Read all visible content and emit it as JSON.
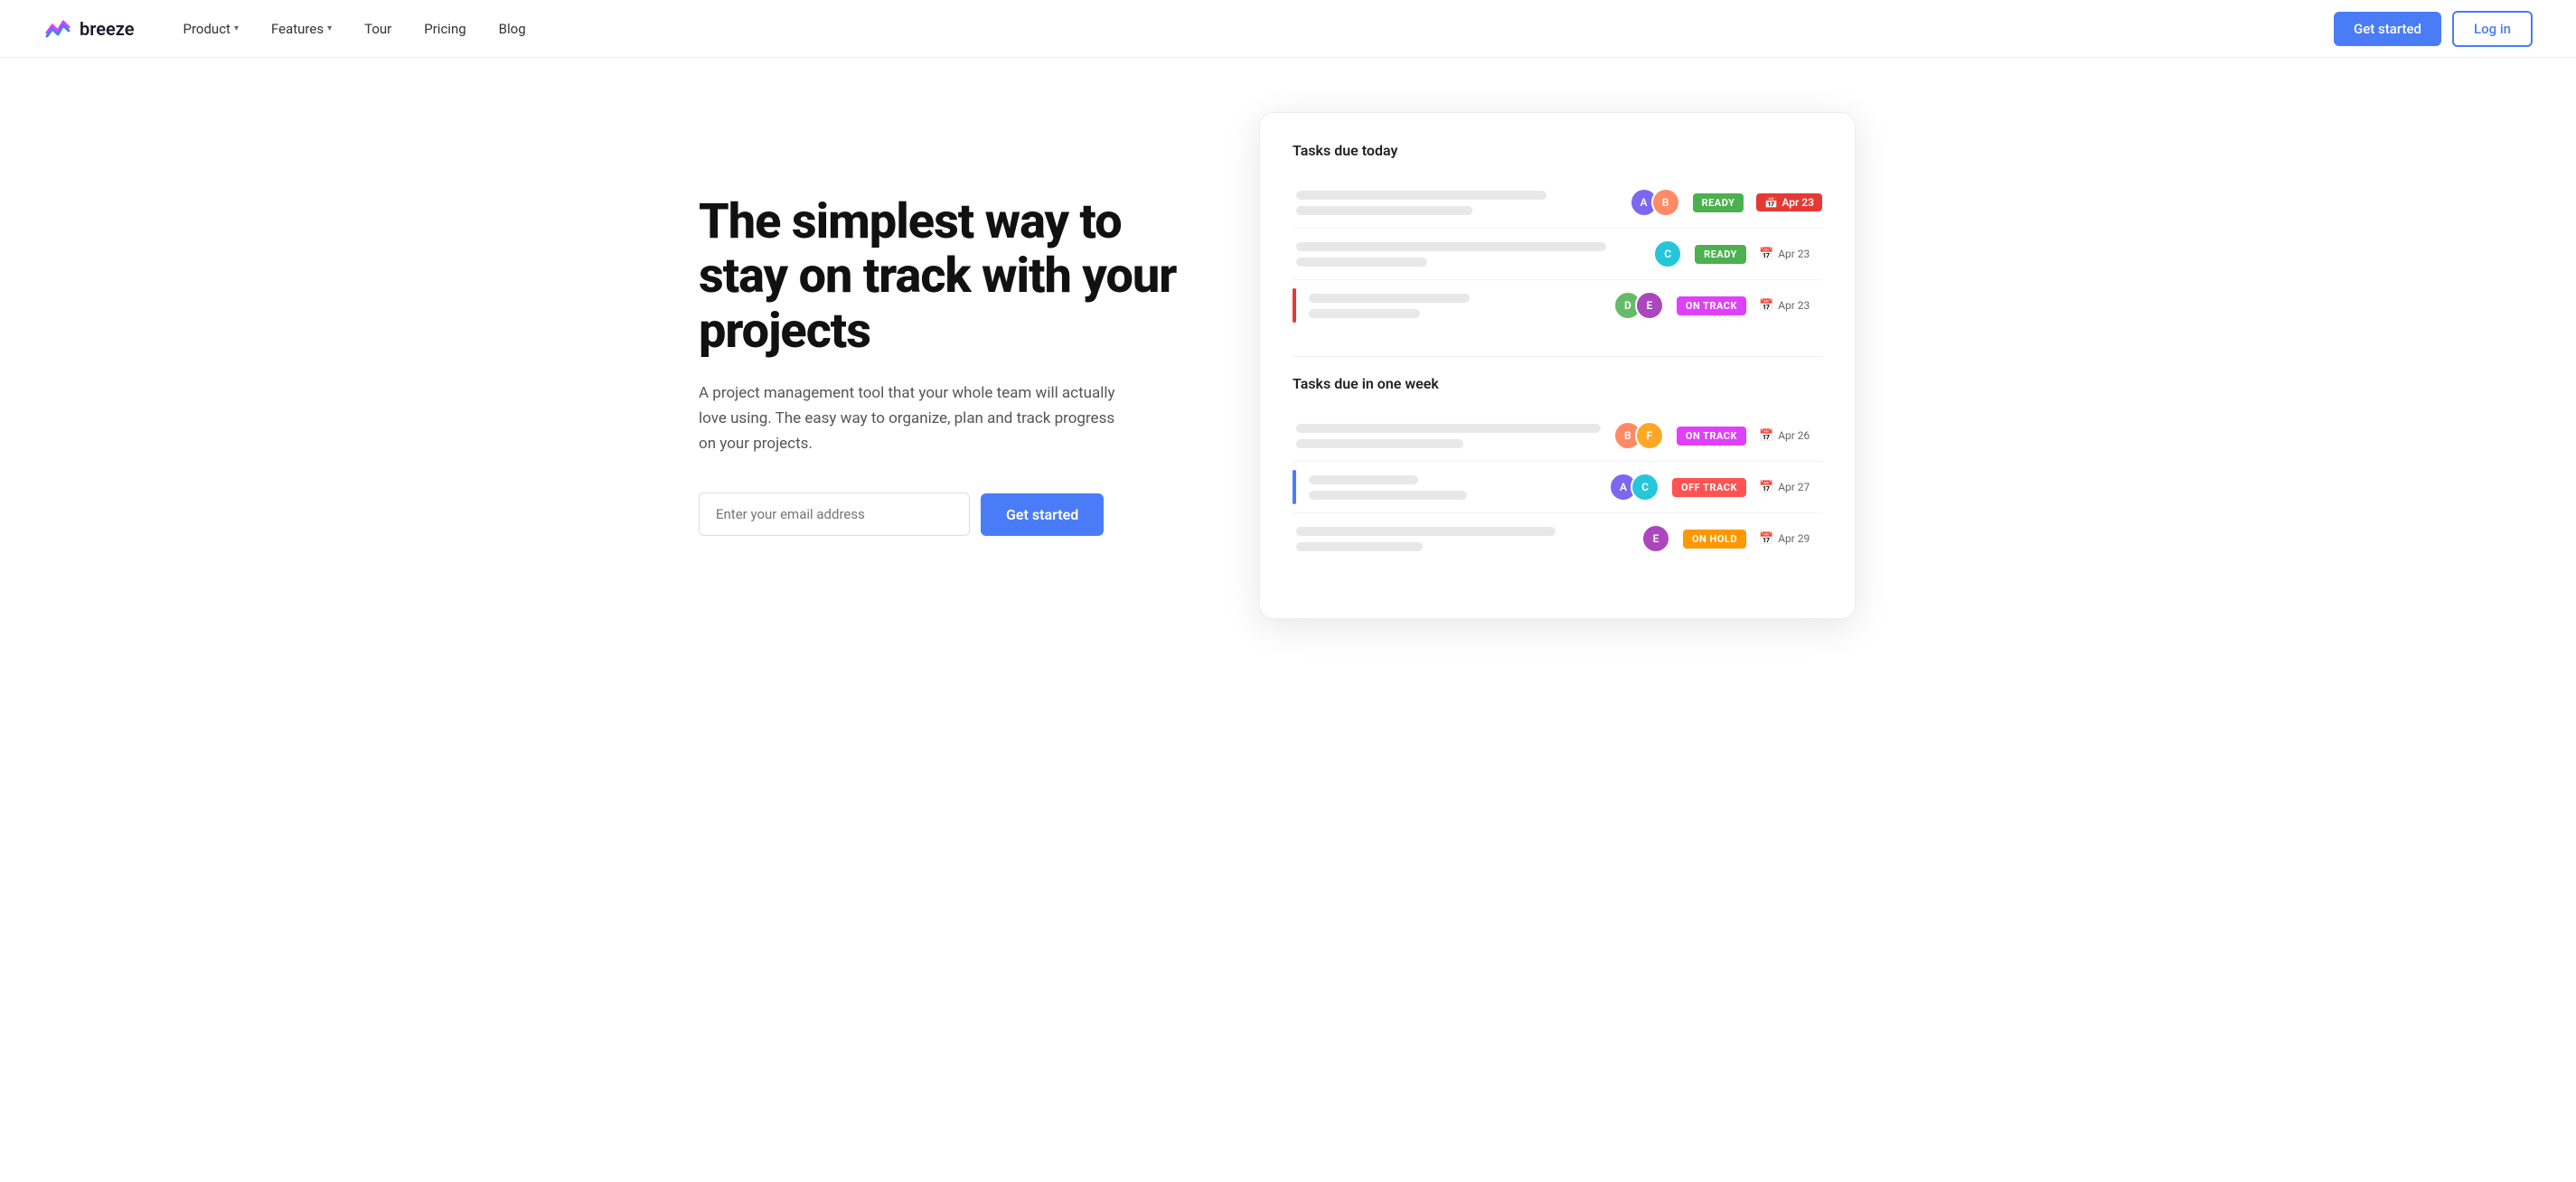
{
  "nav": {
    "logo_text": "breeze",
    "links": [
      {
        "label": "Product",
        "has_dropdown": true
      },
      {
        "label": "Features",
        "has_dropdown": true
      },
      {
        "label": "Tour",
        "has_dropdown": false
      },
      {
        "label": "Pricing",
        "has_dropdown": false
      },
      {
        "label": "Blog",
        "has_dropdown": false
      }
    ],
    "get_started": "Get started",
    "login": "Log in"
  },
  "hero": {
    "title": "The simplest way to stay on track with your projects",
    "subtitle": "A project management tool that your whole team will actually love using. The easy way to organize, plan and track progress on your projects.",
    "email_placeholder": "Enter your email address",
    "get_started_btn": "Get started"
  },
  "dashboard": {
    "section1_title": "Tasks due today",
    "section2_title": "Tasks due in one week",
    "tasks_today": [
      {
        "badge": "READY",
        "badge_type": "ready",
        "due_date": "Apr 23",
        "due_highlight": true,
        "avatars": [
          "av-1",
          "av-2"
        ],
        "bar": null
      },
      {
        "badge": "READY",
        "badge_type": "ready",
        "due_date": "Apr 23",
        "due_highlight": false,
        "avatars": [
          "av-3"
        ],
        "bar": null
      },
      {
        "badge": "ON TRACK",
        "badge_type": "on-track",
        "due_date": "Apr 23",
        "due_highlight": false,
        "avatars": [
          "av-4",
          "av-5"
        ],
        "bar": "#e53935"
      }
    ],
    "tasks_week": [
      {
        "badge": "ON TRACK",
        "badge_type": "on-track",
        "due_date": "Apr 26",
        "due_highlight": false,
        "avatars": [
          "av-2",
          "av-6"
        ],
        "bar": null
      },
      {
        "badge": "OFF TRACK",
        "badge_type": "off-track",
        "due_date": "Apr 27",
        "due_highlight": false,
        "avatars": [
          "av-1",
          "av-3"
        ],
        "bar": "#4A7CF7"
      },
      {
        "badge": "ON HOLD",
        "badge_type": "on-hold",
        "due_date": "Apr 29",
        "due_highlight": false,
        "avatars": [
          "av-5"
        ],
        "bar": null
      }
    ]
  }
}
